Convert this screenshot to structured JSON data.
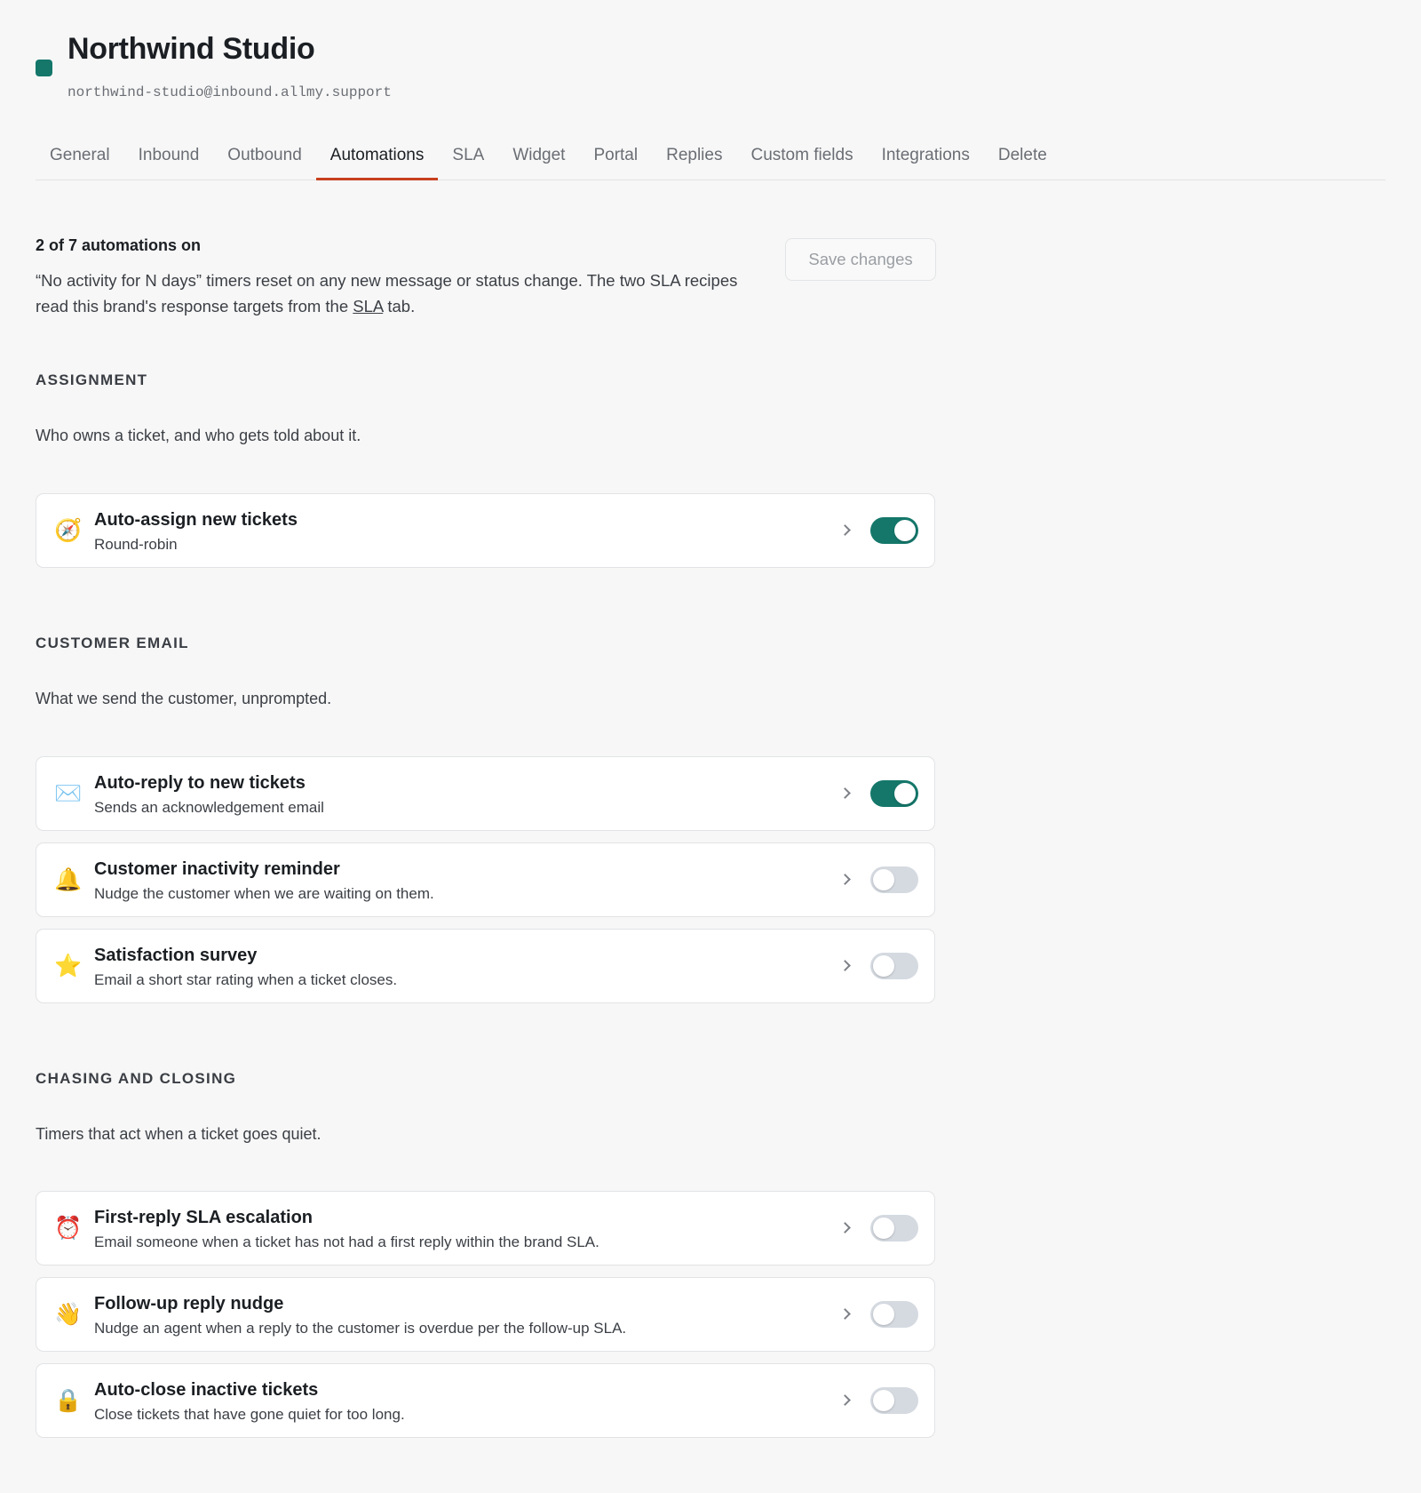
{
  "brand": {
    "name": "Northwind Studio",
    "email": "northwind-studio@inbound.allmy.support",
    "color": "#14776a"
  },
  "tabs": [
    {
      "label": "General",
      "active": false
    },
    {
      "label": "Inbound",
      "active": false
    },
    {
      "label": "Outbound",
      "active": false
    },
    {
      "label": "Automations",
      "active": true
    },
    {
      "label": "SLA",
      "active": false
    },
    {
      "label": "Widget",
      "active": false
    },
    {
      "label": "Portal",
      "active": false
    },
    {
      "label": "Replies",
      "active": false
    },
    {
      "label": "Custom fields",
      "active": false
    },
    {
      "label": "Integrations",
      "active": false
    },
    {
      "label": "Delete",
      "active": false
    }
  ],
  "intro": {
    "count": "2 of 7 automations on",
    "note_part1": "“No activity for N days” timers reset on any new message or status change. The two SLA recipes read this brand's response targets from the",
    "note_link": "SLA",
    "note_part2": "tab."
  },
  "save_button": "Save changes",
  "sections": {
    "assignment": {
      "title": "ASSIGNMENT",
      "description": "Who owns a ticket, and who gets told about it.",
      "items": [
        {
          "icon": "compass-icon",
          "glyph": "🧭",
          "title": "Auto-assign new tickets",
          "subtitle": "Round-robin",
          "enabled": true
        }
      ]
    },
    "customer_email": {
      "title": "CUSTOMER EMAIL",
      "description": "What we send the customer, unprompted.",
      "items": [
        {
          "icon": "envelope-icon",
          "glyph": "✉️",
          "title": "Auto-reply to new tickets",
          "subtitle": "Sends an acknowledgement email",
          "enabled": true
        },
        {
          "icon": "bell-icon",
          "glyph": "🔔",
          "title": "Customer inactivity reminder",
          "subtitle": "Nudge the customer when we are waiting on them.",
          "enabled": false
        },
        {
          "icon": "star-icon",
          "glyph": "⭐",
          "title": "Satisfaction survey",
          "subtitle": "Email a short star rating when a ticket closes.",
          "enabled": false
        }
      ]
    },
    "chasing": {
      "title": "CHASING AND CLOSING",
      "description": "Timers that act when a ticket goes quiet.",
      "items": [
        {
          "icon": "alarm-clock-icon",
          "glyph": "⏰",
          "title": "First-reply SLA escalation",
          "subtitle": "Email someone when a ticket has not had a first reply within the brand SLA.",
          "enabled": false
        },
        {
          "icon": "waving-hand-icon",
          "glyph": "👋",
          "title": "Follow-up reply nudge",
          "subtitle": "Nudge an agent when a reply to the customer is overdue per the follow-up SLA.",
          "enabled": false
        },
        {
          "icon": "lock-icon",
          "glyph": "🔒",
          "title": "Auto-close inactive tickets",
          "subtitle": "Close tickets that have gone quiet for too long.",
          "enabled": false
        }
      ]
    }
  }
}
